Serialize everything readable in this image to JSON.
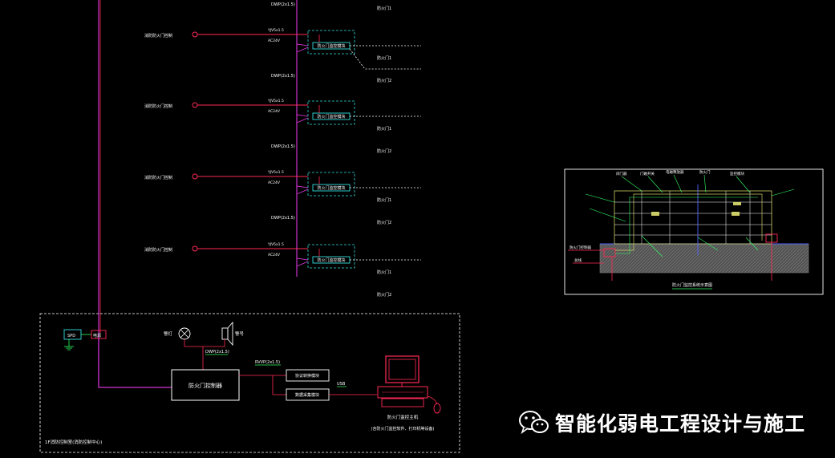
{
  "colors": {
    "background": "#000000",
    "bus_magenta": "#cc33cc",
    "red_line": "#ff2a55",
    "cyan_box": "#33dddd",
    "white": "#ffffff",
    "green_label": "#33ff66",
    "blue_line": "#5566ff"
  },
  "branches": [
    {
      "device_label": "消防防火门控制",
      "cable_top": "YJV5x1.5",
      "cable_bottom": "AC24V",
      "module_label": "防火门监控模块",
      "bus_cable": "DWP(2x1.5)",
      "door_left": "防火门1",
      "door_right": "防火门2"
    },
    {
      "device_label": "消防防火门控制",
      "cable_top": "YJV5x1.5",
      "cable_bottom": "AC24V",
      "module_label": "防火门监控模块",
      "bus_cable": "DWP(2x1.5)",
      "door_left": "防火门1",
      "door_right": "防火门2"
    },
    {
      "device_label": "消防防火门控制",
      "cable_top": "YJV5x1.5",
      "cable_bottom": "AC24V",
      "module_label": "防火门监控模块",
      "bus_cable": "DWP(2x1.5)",
      "door_left": "防火门1",
      "door_right": "防火门2"
    },
    {
      "device_label": "消防防火门控制",
      "cable_top": "YJV5x1.5",
      "cable_bottom": "AC24V",
      "module_label": "防火门监控模块",
      "bus_cable": "",
      "door_left": "防火门1",
      "door_right": "防火门2"
    }
  ],
  "top_bus_cable": "DWP(2x1.5)",
  "control_room": {
    "spd_label": "SPD",
    "power_label": "电源",
    "alarm_label": "警灯",
    "horn_label": "警号",
    "alarm_cable": "DWP(2x1.5)",
    "controller_label": "防火门控制器",
    "network_cable": "RVVP(2x1.5)",
    "converter_top": "协议转换模块",
    "converter_bottom": "数据采集模块",
    "usb_label": "USB",
    "pc_label": "防火门监控主机",
    "pc_sublabel": "(含防火门监控软件、打印机等设备)",
    "room_label": "1F消防控制室(消防控制中心)"
  },
  "detail": {
    "title": "防火门监控系统示意图",
    "labels": [
      "闭门器",
      "门磁开关",
      "电磁释放器",
      "防火门",
      "监控模块",
      "防火门控制器",
      "总线"
    ]
  },
  "watermark": {
    "icon": "wechat-icon",
    "text": "智能化弱电工程设计与施工"
  }
}
